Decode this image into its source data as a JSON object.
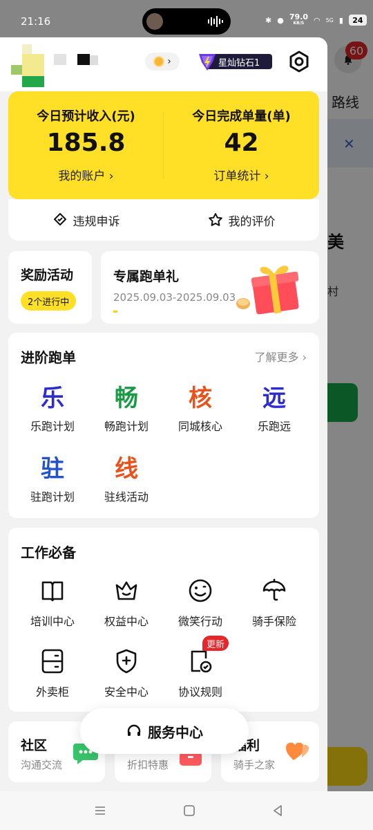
{
  "status_bar": {
    "time": "21:16",
    "network_speed": "79.0",
    "network_unit": "KB/S",
    "signal_label": "5G",
    "battery": "24"
  },
  "background": {
    "badge_count": "60",
    "route_label": "路线",
    "mei_text": "美",
    "cun_text": "村"
  },
  "header": {
    "level_badge": "星灿钻石1"
  },
  "income_card": {
    "today_income_label": "今日预计收入(元)",
    "today_income_value": "185.8",
    "account_link": "我的账户 ›",
    "today_orders_label": "今日完成单量(单)",
    "today_orders_value": "42",
    "order_stats_link": "订单统计 ›"
  },
  "quick_links": {
    "complaint": "违规申诉",
    "my_rating": "我的评价"
  },
  "rewards": {
    "title": "奖励活动",
    "ongoing": "2个进行中"
  },
  "exclusive": {
    "title": "专属跑单礼",
    "date_range": "2025.09.03-2025.09.03",
    "progress_fraction": 0.02
  },
  "advanced": {
    "title": "进阶跑单",
    "more": "了解更多 ›",
    "items": [
      {
        "glyph": "乐",
        "label": "乐跑计划",
        "color": "#2c2ccf"
      },
      {
        "glyph": "畅",
        "label": "畅跑计划",
        "color": "#1a9a45"
      },
      {
        "glyph": "核",
        "label": "同城核心",
        "color": "#e8521c"
      },
      {
        "glyph": "远",
        "label": "乐跑远",
        "color": "#2c2ccf"
      },
      {
        "glyph": "驻",
        "label": "驻跑计划",
        "color": "#2352c9"
      },
      {
        "glyph": "线",
        "label": "驻线活动",
        "color": "#e8521c"
      }
    ]
  },
  "essentials": {
    "title": "工作必备",
    "items": [
      {
        "label": "培训中心",
        "icon": "book-icon"
      },
      {
        "label": "权益中心",
        "icon": "crown-icon"
      },
      {
        "label": "微笑行动",
        "icon": "smile-icon"
      },
      {
        "label": "骑手保险",
        "icon": "umbrella-icon"
      },
      {
        "label": "外卖柜",
        "icon": "locker-icon"
      },
      {
        "label": "安全中心",
        "icon": "shield-plus-icon"
      },
      {
        "label": "协议规则",
        "icon": "document-check-icon",
        "badge": "更新"
      }
    ]
  },
  "bottom_cards": {
    "community_title": "社区",
    "community_sub": "沟通交流",
    "discount_sub": "折扣特惠",
    "welfare_title": "福利",
    "welfare_sub": "骑手之家"
  },
  "service_center": {
    "label": "服务中心"
  },
  "colors": {
    "brand_yellow": "#ffe027",
    "badge_red": "#e5262a"
  }
}
